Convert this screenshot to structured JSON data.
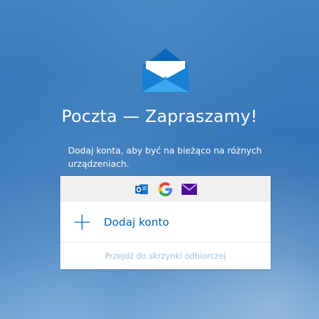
{
  "app": {
    "title": "Poczta — Zapraszamy!",
    "subtitle": "Dodaj konta, aby być na bieżąco na różnych urządzeniach."
  },
  "providers": [
    {
      "icon": "outlook-icon"
    },
    {
      "icon": "google-icon"
    },
    {
      "icon": "yahoo-mail-icon"
    }
  ],
  "card": {
    "add_account_label": "Dodaj konto",
    "goto_inbox_label": "Przejdź do skrzynki odbiorczej"
  },
  "colors": {
    "accent": "#0067b8",
    "background": "#3a7cbc",
    "link_muted": "#9cc1e4",
    "provider_bar": "#f0f0f0"
  }
}
